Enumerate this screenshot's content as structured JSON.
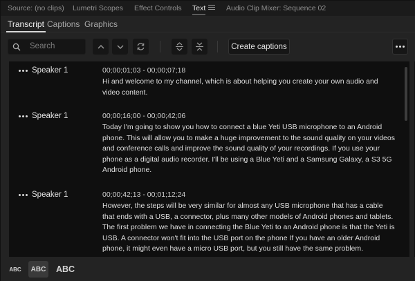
{
  "panel_tabs": [
    {
      "label": "Source: (no clips)"
    },
    {
      "label": "Lumetri Scopes"
    },
    {
      "label": "Effect Controls"
    },
    {
      "label": "Text"
    },
    {
      "label": "Audio Clip Mixer: Sequence 02"
    }
  ],
  "sub_tabs": [
    {
      "label": "Transcript"
    },
    {
      "label": "Captions"
    },
    {
      "label": "Graphics"
    }
  ],
  "toolbar": {
    "search_placeholder": "Search",
    "create_captions": "Create captions"
  },
  "segments": [
    {
      "speaker": "Speaker 1",
      "timecode": "00;00;01;03 - 00;00;07;18",
      "text": "Hi and welcome to my channel, which is about helping you create your own audio and video content."
    },
    {
      "speaker": "Speaker 1",
      "timecode": "00;00;16;00 - 00;00;42;06",
      "text": "Today I'm going to show you how to connect a blue Yeti USB microphone to an Android phone. This will allow you to make a huge improvement to the sound quality on your videos and conference calls and improve the sound quality of your recordings. If you use your phone as a digital audio recorder. I'll be using a Blue Yeti and a Samsung Galaxy, a S3 5G Android phone."
    },
    {
      "speaker": "Speaker 1",
      "timecode": "00;00;42;13 - 00;01;12;24",
      "text": "However, the steps will be very similar for almost any USB microphone that has a cable that ends with a USB, a connector, plus many other models of Android phones and tablets. The first problem we have in connecting the Blue Yeti to an Android phone is that the Yeti is USB. A connector won't fit into the USB port on the phone If you have an older Android phone, it might even have a micro USB port, but you still have the same problem."
    }
  ],
  "text_size": {
    "small": "ABC",
    "medium": "ABC",
    "large": "ABC",
    "selected": "medium"
  },
  "colors": {
    "background": "#232323",
    "list_background": "#0f0f0f",
    "text": "#dedede"
  }
}
